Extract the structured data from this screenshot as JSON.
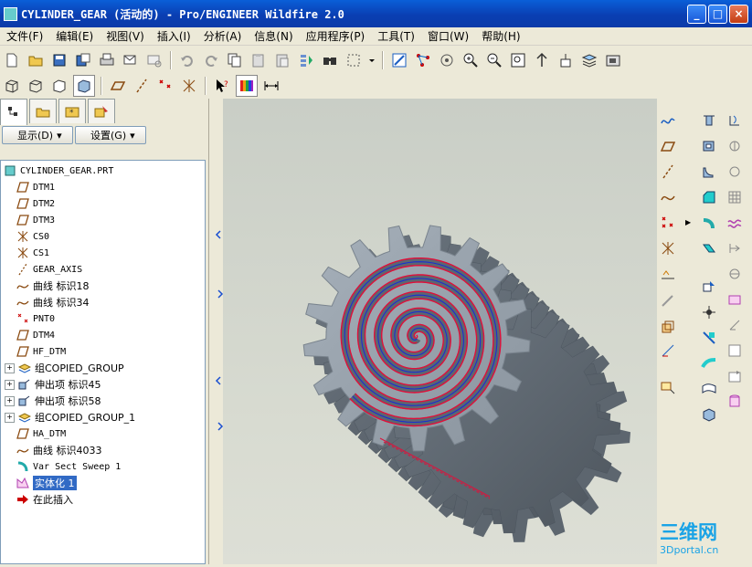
{
  "window": {
    "title": "CYLINDER_GEAR (活动的) - Pro/ENGINEER Wildfire 2.0"
  },
  "menu": [
    "文件(F)",
    "编辑(E)",
    "视图(V)",
    "插入(I)",
    "分析(A)",
    "信息(N)",
    "应用程序(P)",
    "工具(T)",
    "窗口(W)",
    "帮助(H)"
  ],
  "navigator": {
    "show_label": "显示(D)",
    "settings_label": "设置(G)"
  },
  "tree": {
    "root": "CYLINDER_GEAR.PRT",
    "items": [
      {
        "label": "DTM1",
        "icon": "datum-plane-icon",
        "expand": false
      },
      {
        "label": "DTM2",
        "icon": "datum-plane-icon",
        "expand": false
      },
      {
        "label": "DTM3",
        "icon": "datum-plane-icon",
        "expand": false
      },
      {
        "label": "CS0",
        "icon": "coordinate-system-icon",
        "expand": false
      },
      {
        "label": "CS1",
        "icon": "coordinate-system-icon",
        "expand": false
      },
      {
        "label": "GEAR_AXIS",
        "icon": "datum-axis-icon",
        "expand": false
      },
      {
        "label": "曲线 标识18",
        "icon": "curve-icon",
        "expand": false
      },
      {
        "label": "曲线 标识34",
        "icon": "curve-icon",
        "expand": false
      },
      {
        "label": "PNT0",
        "icon": "datum-point-icon",
        "expand": false
      },
      {
        "label": "DTM4",
        "icon": "datum-plane-icon",
        "expand": false
      },
      {
        "label": "HF_DTM",
        "icon": "datum-plane-icon",
        "expand": false
      },
      {
        "label": "组COPIED_GROUP",
        "icon": "group-icon",
        "expand": true
      },
      {
        "label": "伸出项 标识45",
        "icon": "extrude-icon",
        "expand": true
      },
      {
        "label": "伸出项 标识58",
        "icon": "extrude-icon",
        "expand": true
      },
      {
        "label": "组COPIED_GROUP_1",
        "icon": "group-icon",
        "expand": true
      },
      {
        "label": "HA_DTM",
        "icon": "datum-plane-icon",
        "expand": false
      },
      {
        "label": "曲线 标识4033",
        "icon": "curve-icon",
        "expand": false
      },
      {
        "label": "Var Sect Sweep 1",
        "icon": "sweep-icon",
        "expand": false
      },
      {
        "label": "实体化 1",
        "icon": "solidify-icon",
        "expand": false,
        "selected": true
      },
      {
        "label": "在此插入",
        "icon": "insert-here-icon",
        "expand": false
      }
    ]
  },
  "watermark": {
    "brand": "三维网",
    "url": "3Dportal.cn"
  },
  "colors": {
    "titlebar": "#0a47c4",
    "selection": "#316ac5",
    "gear": "#8f9aa6",
    "spiral_red": "#e0103a",
    "spiral_blue": "#1a2fd0"
  }
}
